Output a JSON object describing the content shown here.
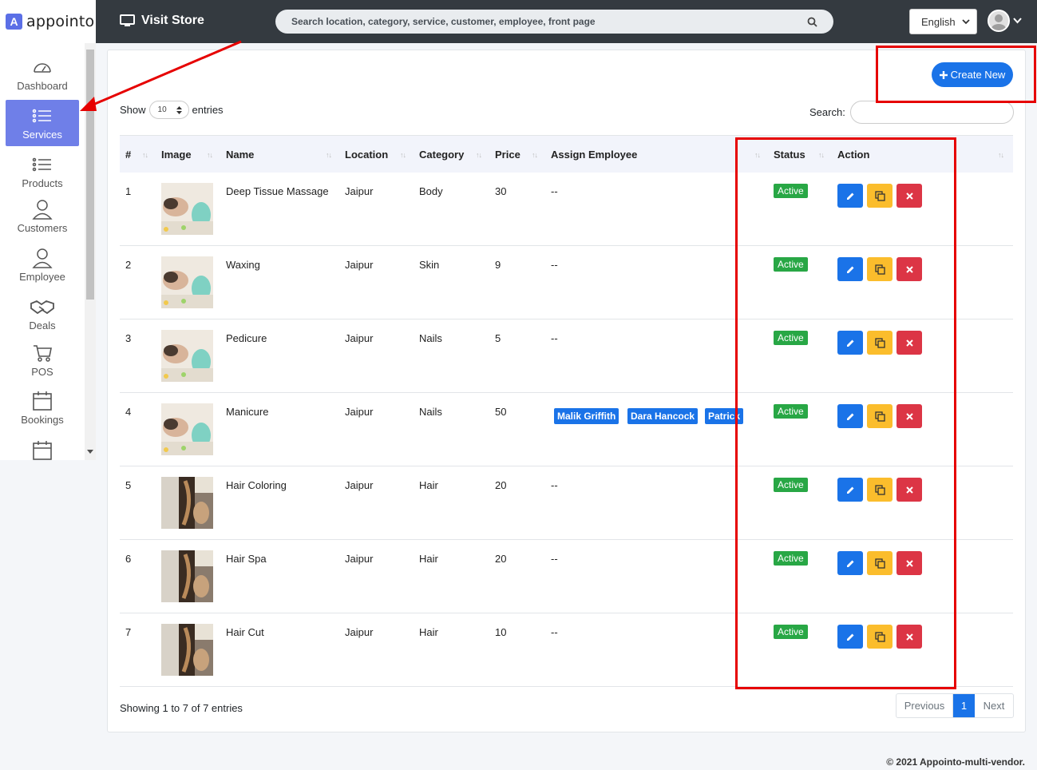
{
  "brand": {
    "logo_letter": "A",
    "name": "appointo"
  },
  "topbar": {
    "visit_store": "Visit Store",
    "search_placeholder": "Search location, category, service, customer, employee, front page",
    "language": "English"
  },
  "sidebar": {
    "items": [
      {
        "label": "Dashboard",
        "icon": "speedometer-icon"
      },
      {
        "label": "Services",
        "icon": "list-icon",
        "active": true
      },
      {
        "label": "Products",
        "icon": "list-icon"
      },
      {
        "label": "Customers",
        "icon": "user-icon"
      },
      {
        "label": "Employee",
        "icon": "user-icon"
      },
      {
        "label": "Deals",
        "icon": "handshake-icon"
      },
      {
        "label": "POS",
        "icon": "cart-icon"
      },
      {
        "label": "Bookings",
        "icon": "calendar-icon"
      }
    ]
  },
  "toolbar": {
    "create_label": "Create New"
  },
  "table_controls": {
    "show_label": "Show",
    "entries_value": "10",
    "entries_label": "entries",
    "search_label": "Search:"
  },
  "table": {
    "columns": [
      "#",
      "Image",
      "Name",
      "Location",
      "Category",
      "Price",
      "Assign Employee",
      "Status",
      "Action"
    ],
    "rows": [
      {
        "num": "1",
        "name": "Deep Tissue Massage",
        "location": "Jaipur",
        "category": "Body",
        "price": "30",
        "employees": "--",
        "status": "Active"
      },
      {
        "num": "2",
        "name": "Waxing",
        "location": "Jaipur",
        "category": "Skin",
        "price": "9",
        "employees": "--",
        "status": "Active"
      },
      {
        "num": "3",
        "name": "Pedicure",
        "location": "Jaipur",
        "category": "Nails",
        "price": "5",
        "employees": "--",
        "status": "Active"
      },
      {
        "num": "4",
        "name": "Manicure",
        "location": "Jaipur",
        "category": "Nails",
        "price": "50",
        "employees": "",
        "employee_tags": [
          "Malik Griffith",
          "Dara Hancock",
          "Patrick"
        ],
        "status": "Active"
      },
      {
        "num": "5",
        "name": "Hair Coloring",
        "location": "Jaipur",
        "category": "Hair",
        "price": "20",
        "employees": "--",
        "status": "Active"
      },
      {
        "num": "6",
        "name": "Hair Spa",
        "location": "Jaipur",
        "category": "Hair",
        "price": "20",
        "employees": "--",
        "status": "Active"
      },
      {
        "num": "7",
        "name": "Hair Cut",
        "location": "Jaipur",
        "category": "Hair",
        "price": "10",
        "employees": "--",
        "status": "Active"
      }
    ]
  },
  "footer_info": {
    "showing": "Showing 1 to 7 of 7 entries",
    "prev": "Previous",
    "page": "1",
    "next": "Next",
    "copyright": "© 2021 Appointo-multi-vendor."
  }
}
